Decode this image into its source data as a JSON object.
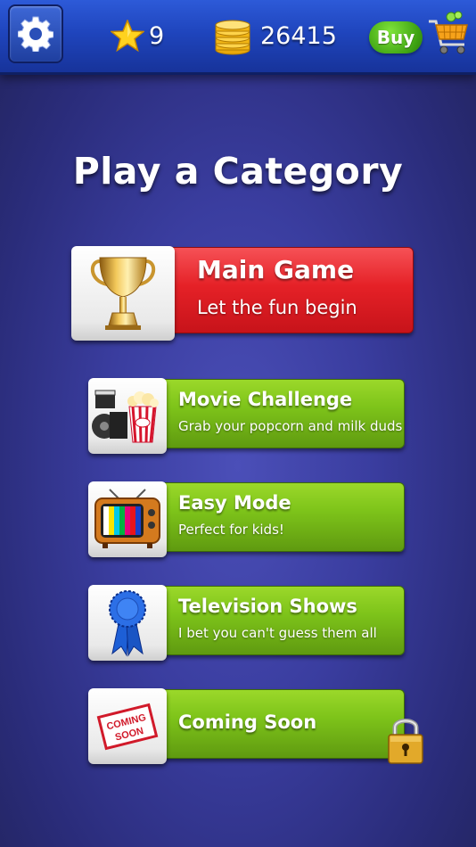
{
  "header": {
    "settings_icon": "gear-icon",
    "stars_icon": "star-icon",
    "stars": "9",
    "coins_icon": "coin-stack-icon",
    "coins": "26415",
    "buy_label": "Buy",
    "cart_icon": "shopping-cart-icon"
  },
  "title": "Play a Category",
  "categories": [
    {
      "title": "Main Game",
      "subtitle": "Let the fun begin",
      "icon": "trophy-icon",
      "color": "#e52127"
    },
    {
      "title": "Movie Challenge",
      "subtitle": "Grab your popcorn and milk duds",
      "icon": "popcorn-film-icon",
      "color": "#7ec41a"
    },
    {
      "title": "Easy Mode",
      "subtitle": "Perfect for kids!",
      "icon": "retro-tv-icon",
      "color": "#7ec41a"
    },
    {
      "title": "Television Shows",
      "subtitle": "I bet you can't guess them all",
      "icon": "blue-ribbon-icon",
      "color": "#7ec41a"
    },
    {
      "title": "Coming Soon",
      "subtitle": "",
      "icon": "coming-soon-stamp-icon",
      "stamp_text": "COMING SOON",
      "color": "#7ec41a",
      "locked": true
    }
  ],
  "colors": {
    "background": "#3a3d9f",
    "topbar": "#1f45bd",
    "red_button": "#e52127",
    "green_button": "#7ec41a"
  }
}
